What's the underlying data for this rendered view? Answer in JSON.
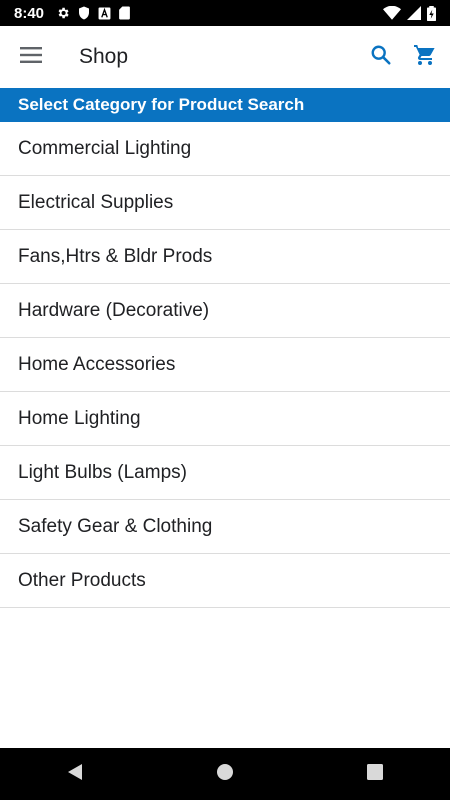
{
  "status_bar": {
    "time": "8:40",
    "icons": [
      "settings-icon",
      "shield-icon",
      "a-box-icon",
      "sd-card-icon",
      "wifi-icon",
      "cell-signal-icon",
      "battery-icon"
    ]
  },
  "app_bar": {
    "title": "Shop",
    "menu_icon": "hamburger-menu-icon",
    "search_icon": "search-icon",
    "cart_icon": "cart-icon"
  },
  "section_header": "Select Category for Product Search",
  "categories": [
    "Commercial Lighting",
    "Electrical Supplies",
    "Fans,Htrs & Bldr Prods",
    "Hardware (Decorative)",
    "Home Accessories",
    "Home Lighting",
    "Light Bulbs (Lamps)",
    "Safety Gear & Clothing",
    "Other Products"
  ],
  "nav_bar": {
    "icons": [
      "back-icon",
      "home-icon",
      "recents-icon"
    ]
  },
  "colors": {
    "accent": "#0a73c1",
    "header_bg": "#0a73c1",
    "status_bar_bg": "#000000",
    "nav_bar_bg": "#000000",
    "divider": "#dcdcdc"
  }
}
